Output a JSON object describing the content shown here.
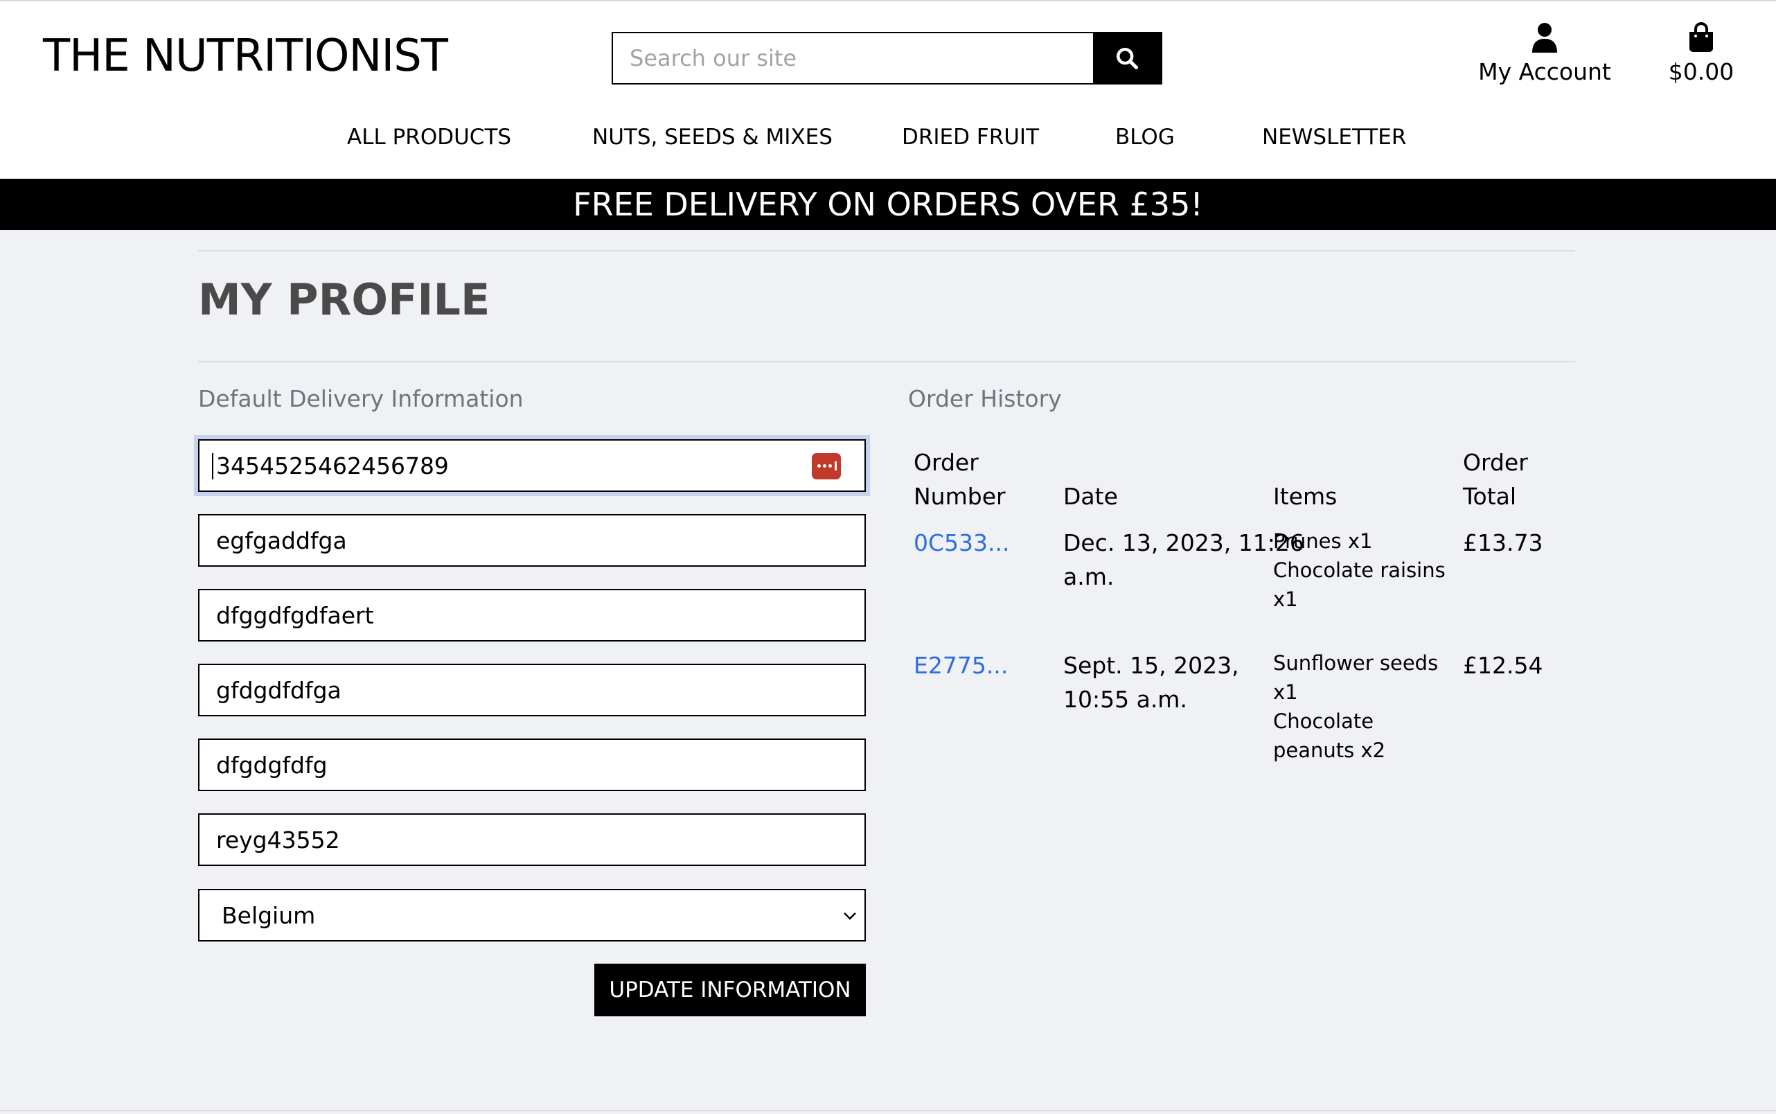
{
  "header": {
    "logo": "THE NUTRITIONIST",
    "search_placeholder": "Search our site",
    "account_label": "My Account",
    "cart_total": "$0.00"
  },
  "nav": {
    "items": [
      "ALL PRODUCTS",
      "NUTS, SEEDS & MIXES",
      "DRIED FRUIT",
      "BLOG",
      "NEWSLETTER"
    ]
  },
  "banner": "FREE DELIVERY ON ORDERS OVER £35!",
  "page": {
    "title": "MY PROFILE",
    "delivery_heading": "Default Delivery Information",
    "history_heading": "Order History"
  },
  "form": {
    "fields": [
      "3454525462456789",
      "egfgaddfga",
      "dfggdfgdfaert",
      "gfdgdfdfga",
      "dfgdgfdfg",
      "reyg43552"
    ],
    "country": "Belgium",
    "submit_label": "UPDATE INFORMATION"
  },
  "orders": {
    "headers": {
      "number_line1": "Order",
      "number_line2": "Number",
      "date": "Date",
      "items": "Items",
      "total_line1": "Order",
      "total_line2": "Total"
    },
    "rows": [
      {
        "number": "0C533...",
        "date_line1": "Dec. 13, 2023, 11:26",
        "date_line2": "a.m.",
        "item_lines": [
          "Prunes x1",
          "Chocolate raisins",
          "x1"
        ],
        "total": "£13.73"
      },
      {
        "number": "E2775...",
        "date_line1": "Sept. 15, 2023,",
        "date_line2": "10:55 a.m.",
        "item_lines": [
          "Sunflower seeds",
          "x1",
          "Chocolate",
          "peanuts x2"
        ],
        "total": "£12.54"
      }
    ]
  },
  "colors": {
    "page_background": "#f0f1f5",
    "banner_background": "#000000",
    "link": "#2b6de0",
    "password_icon": "#c0392b",
    "focus_ring": "#c5d3ee"
  },
  "icons": {
    "search": "search-icon",
    "account": "user-icon",
    "cart": "shopping-bag-icon",
    "password_manager": "password-manager-icon",
    "select": "chevron-down-icon"
  }
}
